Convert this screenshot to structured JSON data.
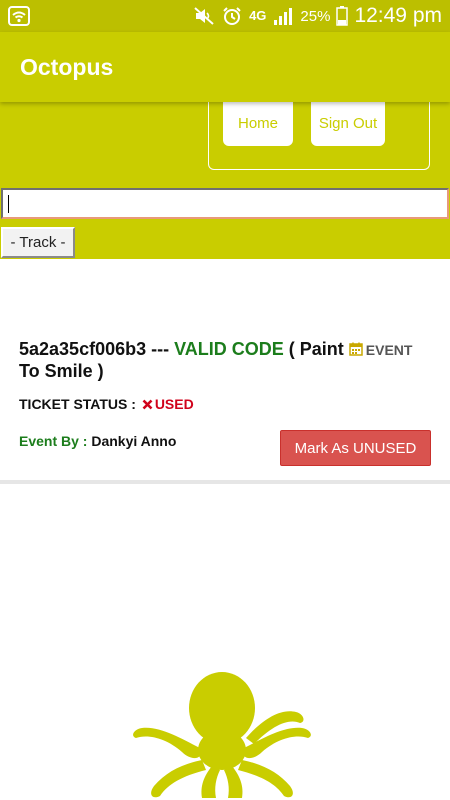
{
  "status_bar": {
    "network": "4G",
    "battery": "25%",
    "time": "12:49 pm",
    "icons": [
      "wifi-icon",
      "mute-icon",
      "alarm-icon",
      "signal-icon",
      "battery-icon"
    ]
  },
  "app_bar": {
    "title": "Octopus"
  },
  "nav": {
    "home_label": "Home",
    "signout_label": "Sign Out"
  },
  "track": {
    "input_value": "",
    "button_label": "- Track -"
  },
  "result": {
    "code": "5a2a35cf006b3",
    "separator": " --- ",
    "validity": "VALID CODE",
    "event_prefix": " ( Paint ",
    "event_tag": "EVENT",
    "event_suffix": " To Smile )",
    "status_label": "TICKET STATUS : ",
    "status_value": "USED",
    "event_by_label": "Event By : ",
    "event_by_value": "Dankyi Anno",
    "action_label": "Mark As UNUSED"
  },
  "colors": {
    "brand": "#c9cd00",
    "valid": "#1c7d1c",
    "used": "#d0021b",
    "danger_button": "#d9534f"
  }
}
